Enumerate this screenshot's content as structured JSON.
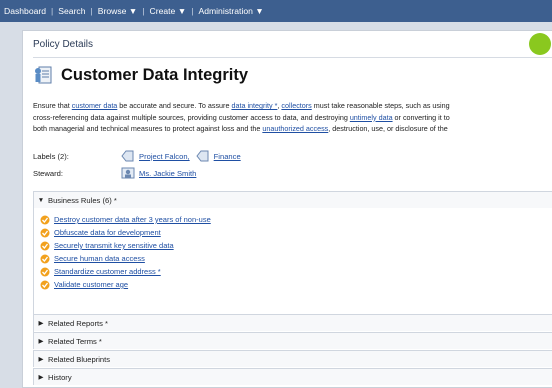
{
  "nav": {
    "items": [
      "Dashboard",
      "Search",
      "Browse ▼",
      "Create ▼",
      "Administration ▼"
    ]
  },
  "page": {
    "section_header": "Policy Details",
    "title": "Customer Data Integrity"
  },
  "description": {
    "line1": [
      "Ensure that ",
      "customer data",
      " be accurate and secure. To assure ",
      "data integrity *",
      ", ",
      "collectors",
      " must take reasonable steps, such as using"
    ],
    "line2": [
      "cross-referencing data against multiple sources, providing customer access to data, and destroying ",
      "untimely data",
      " or converting it to"
    ],
    "line3": [
      "both managerial and technical measures to protect against loss and the ",
      "unauthorized access",
      ", destruction, use, or disclosure of the"
    ]
  },
  "labels": {
    "label": "Labels (2):",
    "items": [
      "Project Falcon,",
      "Finance"
    ]
  },
  "steward": {
    "label": "Steward:",
    "name": "Ms. Jackie Smith"
  },
  "business_rules": {
    "header": "Business Rules (6) *",
    "items": [
      "Destroy customer data after 3 years of non-use",
      "Obfuscate data for development",
      "Securely transmit key sensitive data",
      "Secure human data access",
      "Standardize customer address *",
      "Validate customer age"
    ]
  },
  "collapsed_sections": [
    "Related Reports *",
    "Related Terms *",
    "Related Blueprints",
    "History"
  ],
  "colors": {
    "nav_bg": "#3d5f8f",
    "link": "#1f4fa3",
    "status_green": "#8ac81f"
  }
}
